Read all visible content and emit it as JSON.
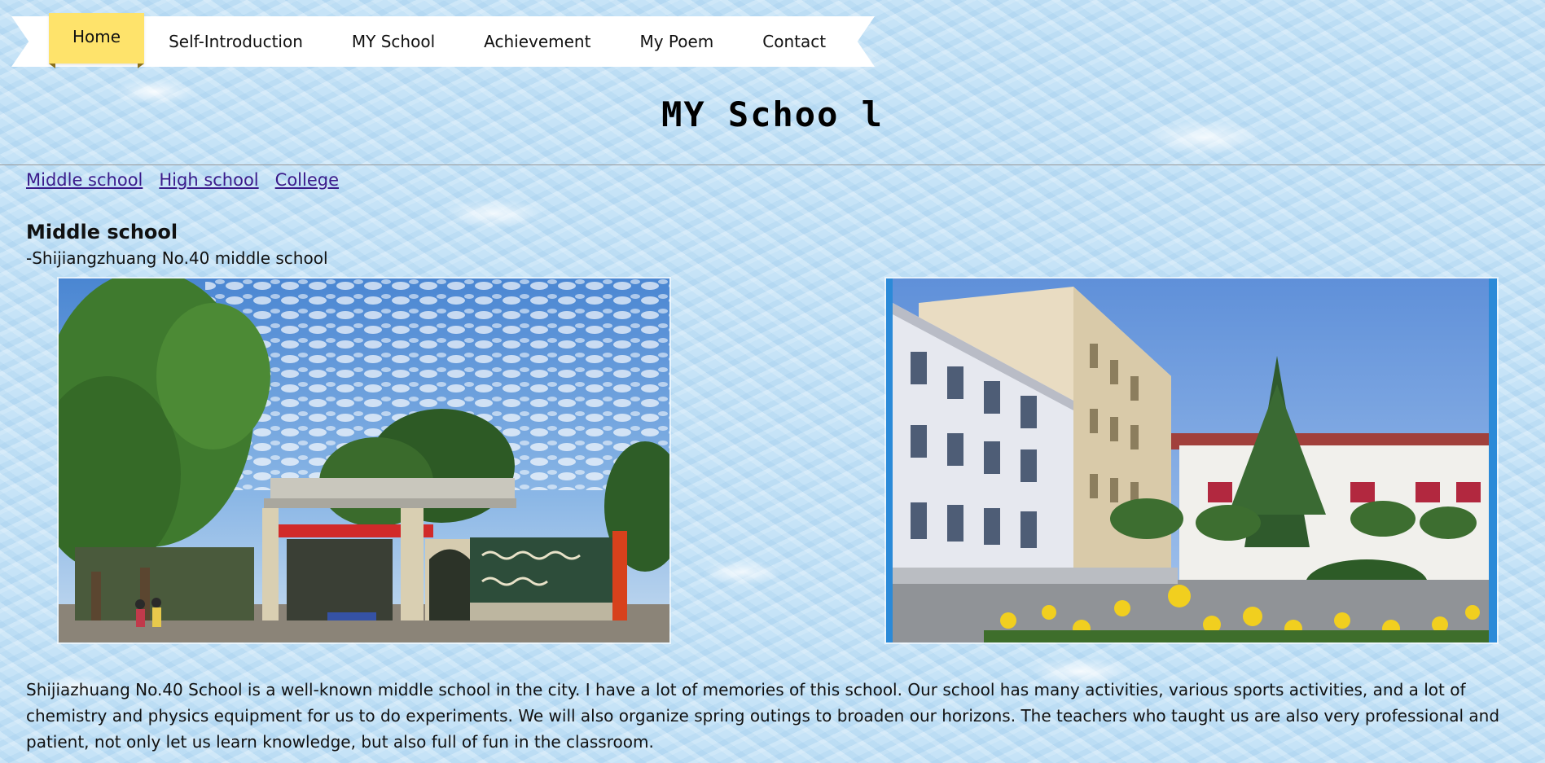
{
  "nav": {
    "items": [
      {
        "label": "Home",
        "active": true
      },
      {
        "label": "Self-Introduction",
        "active": false
      },
      {
        "label": "MY School",
        "active": false
      },
      {
        "label": "Achievement",
        "active": false
      },
      {
        "label": "My Poem",
        "active": false
      },
      {
        "label": "Contact",
        "active": false
      }
    ],
    "active_color": "#fee36b"
  },
  "page_title": "MY Schoo l",
  "subnav": {
    "links": [
      "Middle school",
      "High school",
      "College"
    ],
    "link_color": "#3a1a8a"
  },
  "section": {
    "heading": "Middle school",
    "subtitle": "-Shijiangzhuang No.40 middle school",
    "photos": [
      {
        "name": "school-gate-photo"
      },
      {
        "name": "school-building-photo"
      }
    ],
    "description": "Shijiazhuang No.40 School is a well-known middle school in the city. I have a lot of memories of this school. Our school has many activities, various sports activities, and a lot of chemistry and physics equipment for us to do experiments. We will also organize spring outings to broaden our horizons. The teachers who taught us are also very professional and patient, not only let us learn knowledge, but also full of fun in the classroom."
  }
}
